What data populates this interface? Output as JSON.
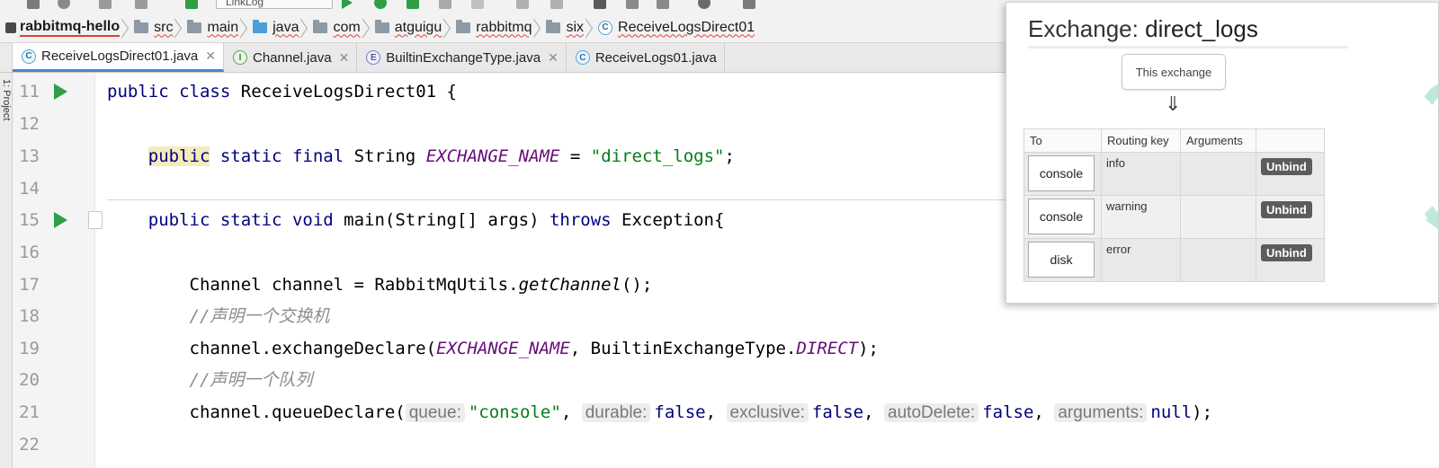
{
  "toolbar": {
    "config_combo": "LinkLog"
  },
  "breadcrumb": [
    {
      "label": "rabbitmq-hello",
      "icon": "module-icon"
    },
    {
      "label": "src",
      "icon": "folder-icon"
    },
    {
      "label": "main",
      "icon": "folder-icon"
    },
    {
      "label": "java",
      "icon": "source-folder-icon"
    },
    {
      "label": "com",
      "icon": "package-icon"
    },
    {
      "label": "atguigu",
      "icon": "package-icon"
    },
    {
      "label": "rabbitmq",
      "icon": "package-icon"
    },
    {
      "label": "six",
      "icon": "package-icon"
    },
    {
      "label": "ReceiveLogsDirect01",
      "icon": "class-icon"
    }
  ],
  "sidebar": {
    "project_label": "1: Project"
  },
  "tabs": [
    {
      "label": "ReceiveLogsDirect01.java",
      "icon_letter": "C",
      "active": true
    },
    {
      "label": "Channel.java",
      "icon_letter": "I",
      "active": false
    },
    {
      "label": "BuiltinExchangeType.java",
      "icon_letter": "E",
      "active": false
    },
    {
      "label": "ReceiveLogs01.java",
      "icon_letter": "C",
      "active": false
    }
  ],
  "editor": {
    "line_numbers": [
      "11",
      "12",
      "13",
      "14",
      "15",
      "16",
      "17",
      "18",
      "19",
      "20",
      "21",
      "22"
    ],
    "l11": {
      "kw1": "public",
      "kw2": "class",
      "name": "ReceiveLogsDirect01 {"
    },
    "l13": {
      "kw1": "public",
      "kw2": "static",
      "kw3": "final",
      "type": "String",
      "const": "EXCHANGE_NAME",
      "eq": " = ",
      "str": "\"direct_logs\"",
      "end": ";"
    },
    "l15": {
      "kw1": "public",
      "kw2": "static",
      "kw3": "void",
      "sig": "main(String[] args) ",
      "kw4": "throws",
      "end": " Exception{"
    },
    "l17": {
      "pre": "Channel channel = RabbitMqUtils.",
      "method": "getChannel",
      "end": "();"
    },
    "l18": {
      "comment": "//声明一个交换机"
    },
    "l19": {
      "pre": "channel.exchangeDeclare(",
      "const1": "EXCHANGE_NAME",
      "mid": ", BuiltinExchangeType.",
      "const2": "DIRECT",
      "end": ");"
    },
    "l20": {
      "comment": "//声明一个队列"
    },
    "l21": {
      "pre": "channel.queueDeclare(",
      "hint_queue": "queue:",
      "val_queue": "\"console\"",
      "c1": ",",
      "hint_durable": "durable:",
      "val_durable": "false",
      "c2": ",",
      "hint_exclusive": "exclusive:",
      "val_exclusive": "false",
      "c3": ",",
      "hint_autodelete": "autoDelete:",
      "val_autodelete": "false",
      "c4": ",",
      "hint_arguments": "arguments:",
      "val_arguments": "null",
      "end": ");"
    }
  },
  "exchange_popup": {
    "title_prefix": "Exchange:",
    "title_name": "direct_logs",
    "this_exchange": "This exchange",
    "arrow": "⇓",
    "columns": [
      "To",
      "Routing key",
      "Arguments",
      ""
    ],
    "bindings": [
      {
        "to": "console",
        "routing_key": "info",
        "arguments": "",
        "action": "Unbind"
      },
      {
        "to": "console",
        "routing_key": "warning",
        "arguments": "",
        "action": "Unbind"
      },
      {
        "to": "disk",
        "routing_key": "error",
        "arguments": "",
        "action": "Unbind"
      }
    ]
  }
}
